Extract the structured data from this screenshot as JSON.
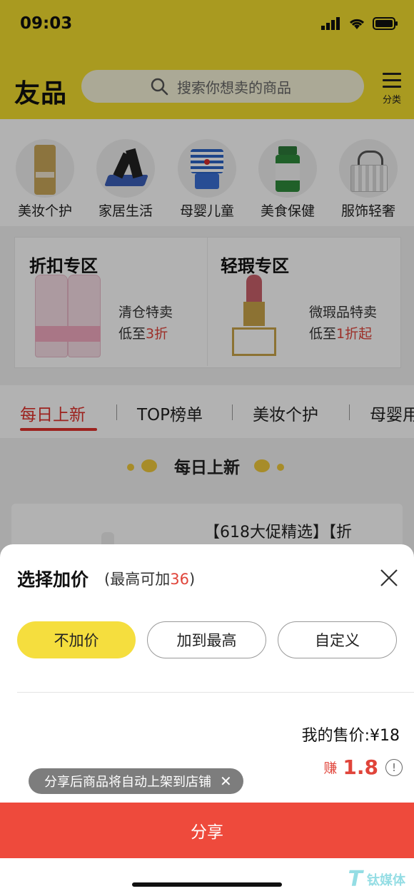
{
  "status": {
    "time": "09:03"
  },
  "header": {
    "logo": "友品",
    "search_placeholder": "搜索你想卖的商品",
    "menu_label": "分类"
  },
  "categories": [
    {
      "label": "美妆个护",
      "icon": "sunscreen-icon"
    },
    {
      "label": "家居生活",
      "icon": "home-decor-icon"
    },
    {
      "label": "母婴儿童",
      "icon": "baby-clothes-icon"
    },
    {
      "label": "美食保健",
      "icon": "supplement-bottle-icon"
    },
    {
      "label": "服饰轻奢",
      "icon": "handbag-icon"
    }
  ],
  "promo": {
    "left": {
      "title": "折扣专区",
      "line1": "清仓特卖",
      "line2_prefix": "低至",
      "line2_value": "3折"
    },
    "right": {
      "title": "轻瑕专区",
      "line1": "微瑕品特卖",
      "line2_prefix": "低至",
      "line2_value": "1折起"
    }
  },
  "tabs": [
    "每日上新",
    "TOP榜单",
    "美妆个护",
    "母婴用"
  ],
  "section_title": "每日上新",
  "product": {
    "title_fragment": "【618大促精选】【折"
  },
  "sheet": {
    "title": "选择加价",
    "subtitle_prefix": "(最高可加",
    "subtitle_value": "36",
    "subtitle_suffix": ")",
    "options": [
      "不加价",
      "加到最高",
      "自定义"
    ],
    "selected_option": 0,
    "price_label": "我的售价:¥18",
    "earn_label": "赚",
    "earn_value": "1.8",
    "toast": "分享后商品将自动上架到店铺",
    "share_button": "分享"
  },
  "colors": {
    "brand_yellow": "#f3dd2e",
    "accent_red": "#e0312b",
    "share_red": "#ee4a3c"
  }
}
